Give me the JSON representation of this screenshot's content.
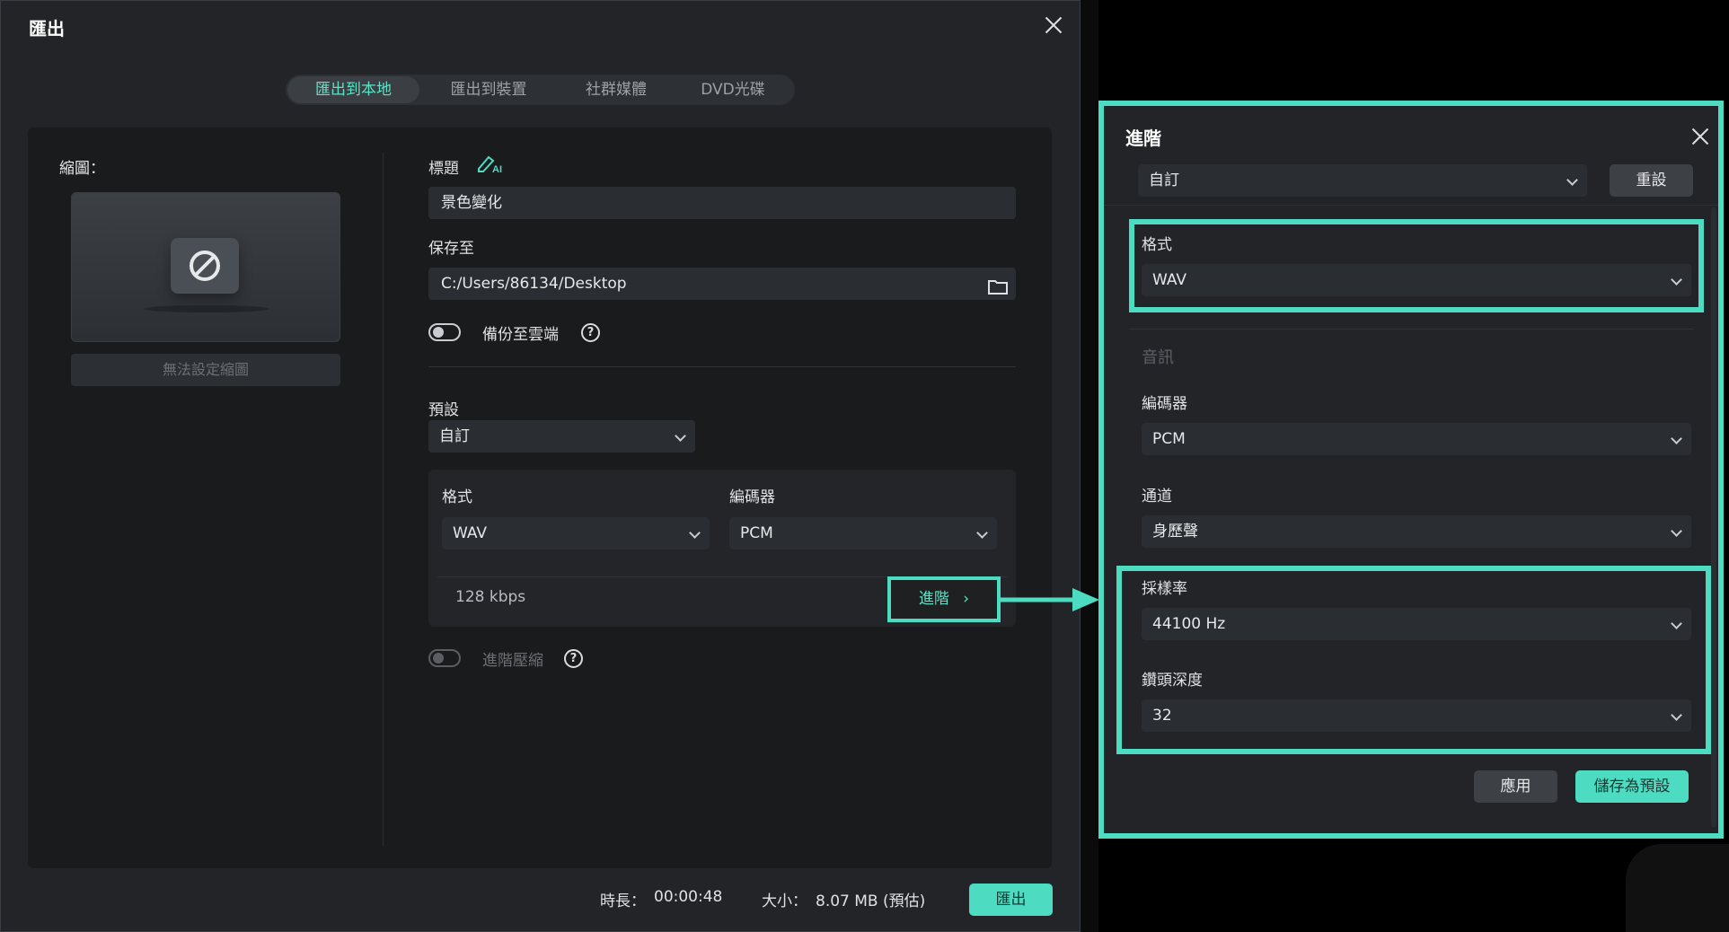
{
  "export_dialog": {
    "title": "匯出",
    "tabs": [
      {
        "label": "匯出到本地",
        "active": true
      },
      {
        "label": "匯出到裝置",
        "active": false
      },
      {
        "label": "社群媒體",
        "active": false
      },
      {
        "label": "DVD光碟",
        "active": false
      }
    ],
    "thumbnail": {
      "label": "縮圖：",
      "button": "無法設定縮圖"
    },
    "title_field": {
      "label": "標題",
      "value": "景色變化",
      "ai_icon": "ai-pen-icon"
    },
    "save_to": {
      "label": "保存至",
      "value": "C:/Users/86134/Desktop",
      "icon": "folder-icon"
    },
    "cloud_backup": {
      "label": "備份至雲端",
      "enabled": false
    },
    "preset": {
      "label": "預設",
      "value": "自訂"
    },
    "format": {
      "label": "格式",
      "value": "WAV"
    },
    "encoder": {
      "label": "編碼器",
      "value": "PCM"
    },
    "bitrate": "128 kbps",
    "advanced_button": "進階",
    "advanced_compression": {
      "label": "進階壓縮",
      "enabled": false
    },
    "footer": {
      "duration_label": "時長：",
      "duration_value": "00:00:48",
      "size_label": "大小：",
      "size_value": "8.07 MB (預估)",
      "export_button": "匯出"
    }
  },
  "advanced_panel": {
    "title": "進階",
    "preset_value": "自訂",
    "reset_button": "重設",
    "format": {
      "label": "格式",
      "value": "WAV"
    },
    "audio_section": "音訊",
    "encoder": {
      "label": "編碼器",
      "value": "PCM"
    },
    "channel": {
      "label": "通道",
      "value": "身歷聲"
    },
    "sample_rate": {
      "label": "採樣率",
      "value": "44100 Hz"
    },
    "bit_depth": {
      "label": "鑽頭深度",
      "value": "32"
    },
    "apply_button": "應用",
    "save_preset_button": "儲存為預設"
  },
  "colors": {
    "accent": "#4cdcc2",
    "dialog_bg": "#222427",
    "panel_bg": "#1a1b1d",
    "control_bg": "#2a2d31"
  }
}
